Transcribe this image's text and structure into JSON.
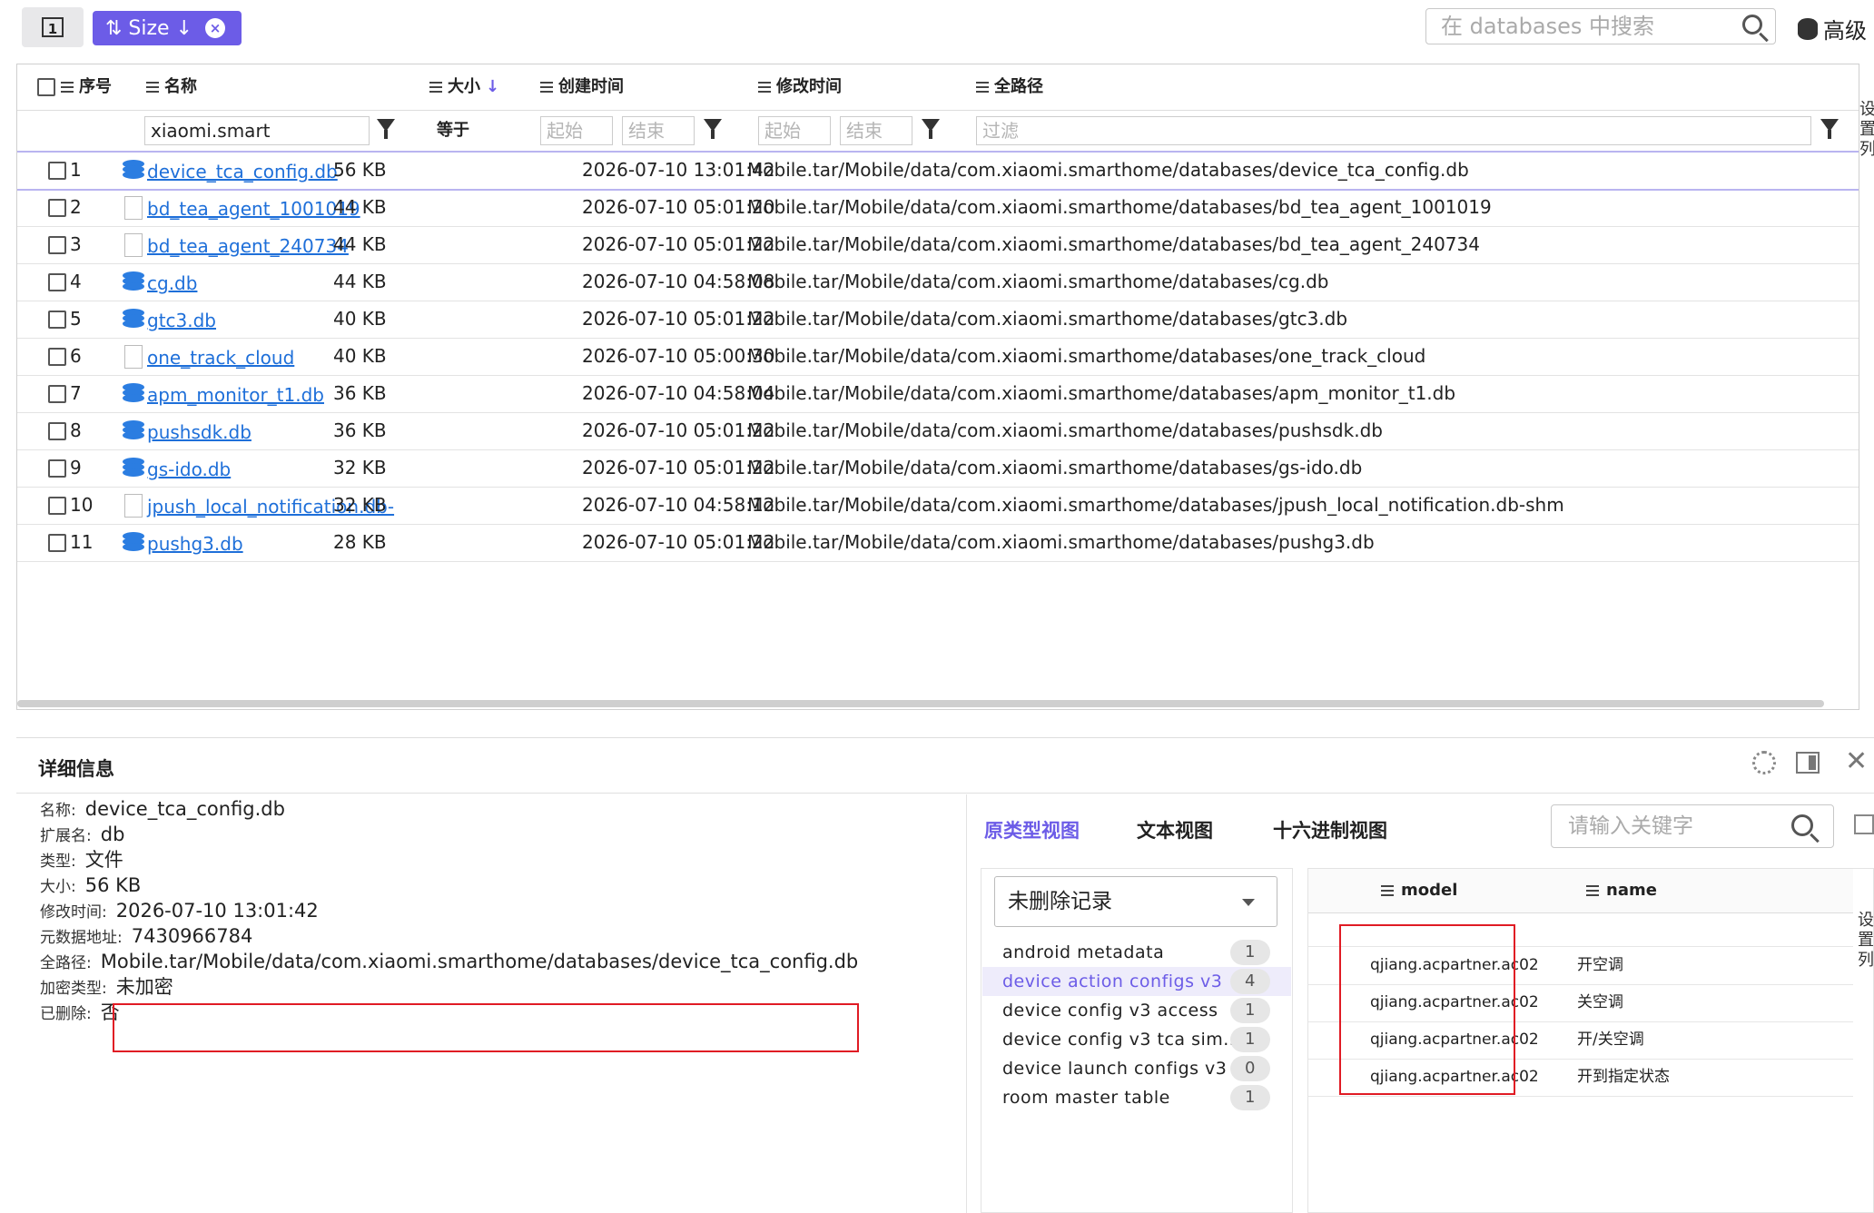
{
  "toolbar": {
    "view_toggle_label": "1",
    "sort_chip_label": "⇅ Size ↓",
    "search_placeholder": "在 databases 中搜索",
    "advanced_label": "高级"
  },
  "table": {
    "columns": {
      "index": "序号",
      "name": "名称",
      "size": "大小",
      "created": "创建时间",
      "modified": "修改时间",
      "path": "全路径"
    },
    "filters": {
      "name_value": "xiaomi.smart",
      "size_label": "等于",
      "created_start": "起始",
      "created_end": "结束",
      "modified_start": "起始",
      "modified_end": "结束",
      "path_placeholder": "过滤"
    },
    "rows": [
      {
        "idx": "1",
        "name": "device_tca_config.db",
        "icon": "database-icon",
        "size": "56 KB",
        "created": "",
        "modified": "2026-07-10 13:01:42",
        "path": "Mobile.tar/Mobile/data/com.xiaomi.smarthome/databases/device_tca_config.db"
      },
      {
        "idx": "2",
        "name": "bd_tea_agent_1001019",
        "icon": "file-icon",
        "size": "44 KB",
        "created": "",
        "modified": "2026-07-10 05:01:20",
        "path": "Mobile.tar/Mobile/data/com.xiaomi.smarthome/databases/bd_tea_agent_1001019"
      },
      {
        "idx": "3",
        "name": "bd_tea_agent_240734",
        "icon": "file-icon",
        "size": "44 KB",
        "created": "",
        "modified": "2026-07-10 05:01:22",
        "path": "Mobile.tar/Mobile/data/com.xiaomi.smarthome/databases/bd_tea_agent_240734"
      },
      {
        "idx": "4",
        "name": "cg.db",
        "icon": "database-icon",
        "size": "44 KB",
        "created": "",
        "modified": "2026-07-10 04:58:08",
        "path": "Mobile.tar/Mobile/data/com.xiaomi.smarthome/databases/cg.db"
      },
      {
        "idx": "5",
        "name": "gtc3.db",
        "icon": "database-icon",
        "size": "40 KB",
        "created": "",
        "modified": "2026-07-10 05:01:22",
        "path": "Mobile.tar/Mobile/data/com.xiaomi.smarthome/databases/gtc3.db"
      },
      {
        "idx": "6",
        "name": "one_track_cloud",
        "icon": "file-icon",
        "size": "40 KB",
        "created": "",
        "modified": "2026-07-10 05:00:30",
        "path": "Mobile.tar/Mobile/data/com.xiaomi.smarthome/databases/one_track_cloud"
      },
      {
        "idx": "7",
        "name": "apm_monitor_t1.db",
        "icon": "database-icon",
        "size": "36 KB",
        "created": "",
        "modified": "2026-07-10 04:58:04",
        "path": "Mobile.tar/Mobile/data/com.xiaomi.smarthome/databases/apm_monitor_t1.db"
      },
      {
        "idx": "8",
        "name": "pushsdk.db",
        "icon": "database-icon",
        "size": "36 KB",
        "created": "",
        "modified": "2026-07-10 05:01:22",
        "path": "Mobile.tar/Mobile/data/com.xiaomi.smarthome/databases/pushsdk.db"
      },
      {
        "idx": "9",
        "name": "gs-ido.db",
        "icon": "database-icon",
        "size": "32 KB",
        "created": "",
        "modified": "2026-07-10 05:01:22",
        "path": "Mobile.tar/Mobile/data/com.xiaomi.smarthome/databases/gs-ido.db"
      },
      {
        "idx": "10",
        "name": "jpush_local_notification.db-",
        "icon": "file-icon",
        "size": "32 KB",
        "created": "",
        "modified": "2026-07-10 04:58:12",
        "path": "Mobile.tar/Mobile/data/com.xiaomi.smarthome/databases/jpush_local_notification.db-shm"
      },
      {
        "idx": "11",
        "name": "pushg3.db",
        "icon": "database-icon",
        "size": "28 KB",
        "created": "",
        "modified": "2026-07-10 05:01:22",
        "path": "Mobile.tar/Mobile/data/com.xiaomi.smarthome/databases/pushg3.db"
      }
    ],
    "side_tab": "设置列"
  },
  "detail": {
    "title": "详细信息",
    "props": [
      {
        "k": "名称:",
        "v": "device_tca_config.db"
      },
      {
        "k": "扩展名:",
        "v": "db"
      },
      {
        "k": "类型:",
        "v": "文件"
      },
      {
        "k": "大小:",
        "v": "56 KB"
      },
      {
        "k": "修改时间:",
        "v": "2026-07-10 13:01:42"
      },
      {
        "k": "元数据地址:",
        "v": "7430966784"
      },
      {
        "k": "全路径:",
        "v": "Mobile.tar/Mobile/data/com.xiaomi.smarthome/databases/device_tca_config.db"
      },
      {
        "k": "加密类型:",
        "v": "未加密"
      },
      {
        "k": "已删除:",
        "v": "否"
      }
    ],
    "tabs": [
      "原类型视图",
      "文本视图",
      "十六进制视图"
    ],
    "search_placeholder": "请输入关键字",
    "select_value": "未删除记录",
    "tables": [
      {
        "name": "android metadata",
        "count": "1"
      },
      {
        "name": "device action configs v3",
        "count": "4"
      },
      {
        "name": "device config v3 access",
        "count": "1"
      },
      {
        "name": "device config v3 tca sim...",
        "count": "1"
      },
      {
        "name": "device launch configs v3",
        "count": "0"
      },
      {
        "name": "room master table",
        "count": "1"
      }
    ],
    "record_columns": {
      "model": "model",
      "name": "name"
    },
    "records": [
      {
        "model": "qjiang.acpartner.ac02",
        "name": "开空调"
      },
      {
        "model": "qjiang.acpartner.ac02",
        "name": "关空调"
      },
      {
        "model": "qjiang.acpartner.ac02",
        "name": "开/关空调"
      },
      {
        "model": "qjiang.acpartner.ac02",
        "name": "开到指定状态"
      }
    ],
    "side_tab": "设置列"
  },
  "colors": {
    "accent": "#6c5ce7",
    "link": "#1e6fd9",
    "highlight": "#e01b24",
    "selected_row": "#eeecfb"
  }
}
